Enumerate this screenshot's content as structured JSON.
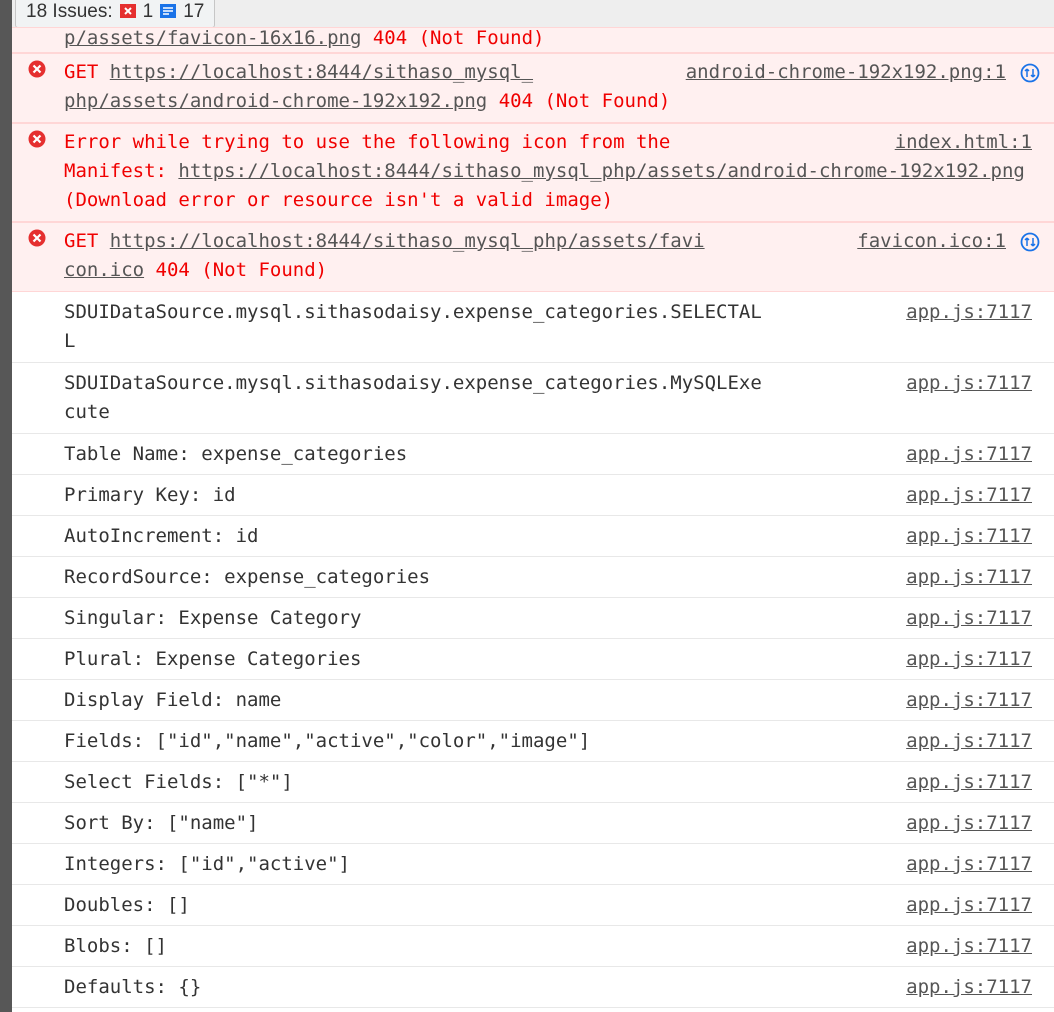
{
  "issues": {
    "label": "18 Issues:",
    "error_count": "1",
    "info_count": "17"
  },
  "colors": {
    "error_text": "#f00000",
    "error_bg": "#fff0f0",
    "link": "#555555"
  },
  "errors": [
    {
      "url_part": "p/assets/favicon-16x16.png",
      "status": " 404 (Not Found)"
    },
    {
      "method": "GET ",
      "url_a": "https://localhost:8444/sithaso_mysql_",
      "url_b": "php/assets/android-chrome-192x192.png",
      "status": " 404 (Not Found)",
      "source": "android-chrome-192x192.png:1"
    },
    {
      "line1": "Error while trying to use the following icon from the",
      "prefix": "Manifest: ",
      "url_a": "https://localhost:8444/sithaso_mysql_php/assets/android-chrome-1",
      "url_b": "92x192.png",
      "suffix": " (Download error or resource isn't a valid image)",
      "source": "index.html:1"
    },
    {
      "method": "GET ",
      "url_a": "https://localhost:8444/sithaso_mysql_php/assets/favi",
      "url_b": "con.ico",
      "status": " 404 (Not Found)",
      "source": "favicon.ico:1"
    }
  ],
  "logs": [
    {
      "line1": "SDUIDataSource.mysql.sithasodaisy.expense_categories.SELECTAL",
      "line2": "L",
      "source": "app.js:7117"
    },
    {
      "line1": "SDUIDataSource.mysql.sithasodaisy.expense_categories.MySQLExe",
      "line2": "cute",
      "source": "app.js:7117"
    },
    {
      "text": "Table Name: expense_categories",
      "source": "app.js:7117"
    },
    {
      "text": "Primary Key: id",
      "source": "app.js:7117"
    },
    {
      "text": "AutoIncrement: id",
      "source": "app.js:7117"
    },
    {
      "text": "RecordSource: expense_categories",
      "source": "app.js:7117"
    },
    {
      "text": "Singular: Expense Category",
      "source": "app.js:7117"
    },
    {
      "text": "Plural: Expense Categories",
      "source": "app.js:7117"
    },
    {
      "text": "Display Field: name",
      "source": "app.js:7117"
    },
    {
      "text": "Fields: [\"id\",\"name\",\"active\",\"color\",\"image\"]",
      "source": "app.js:7117"
    },
    {
      "text": "Select Fields: [\"*\"]",
      "source": "app.js:7117"
    },
    {
      "text": "Sort By: [\"name\"]",
      "source": "app.js:7117"
    },
    {
      "text": "Integers: [\"id\",\"active\"]",
      "source": "app.js:7117"
    },
    {
      "text": "Doubles: []",
      "source": "app.js:7117"
    },
    {
      "text": "Blobs: []",
      "source": "app.js:7117"
    },
    {
      "text": "Defaults: {}",
      "source": "app.js:7117"
    }
  ]
}
